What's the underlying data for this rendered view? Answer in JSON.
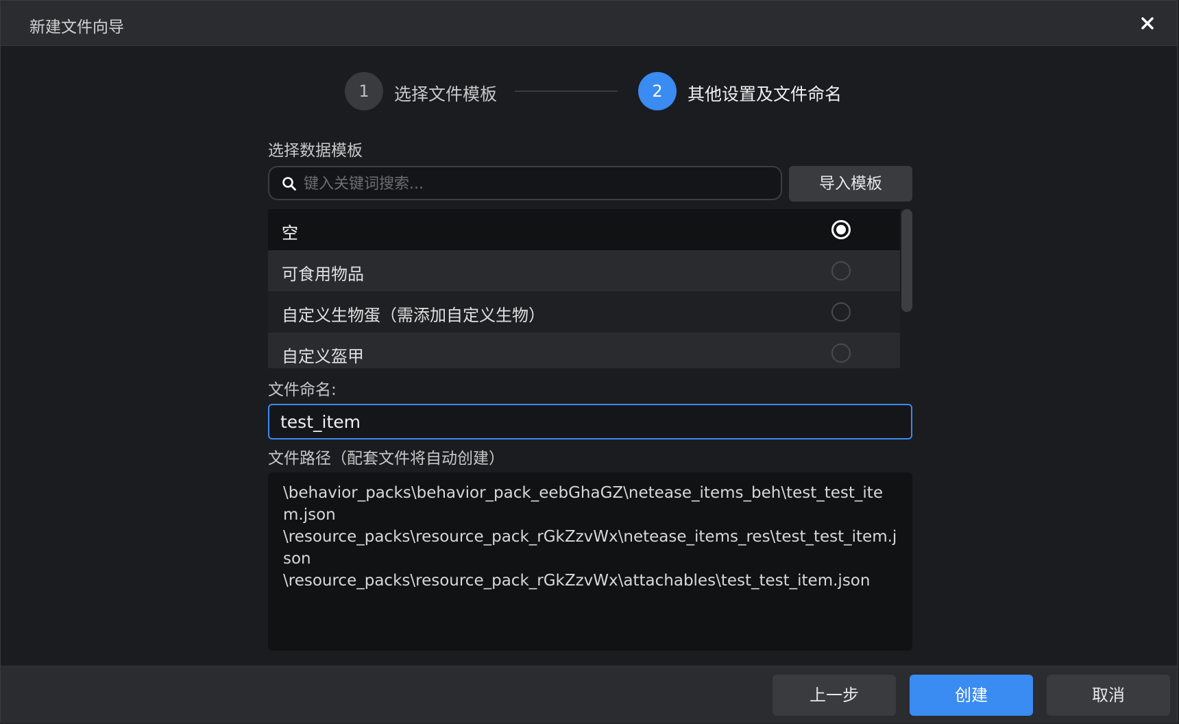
{
  "window": {
    "title": "新建文件向导"
  },
  "stepper": {
    "steps": [
      {
        "number": "1",
        "label": "选择文件模板",
        "state": "done"
      },
      {
        "number": "2",
        "label": "其他设置及文件命名",
        "state": "active"
      }
    ]
  },
  "template_section": {
    "label": "选择数据模板",
    "search_placeholder": "键入关键词搜索...",
    "import_label": "导入模板",
    "items": [
      {
        "label": "空",
        "selected": true
      },
      {
        "label": "可食用物品",
        "selected": false
      },
      {
        "label": "自定义生物蛋（需添加自定义生物）",
        "selected": false
      },
      {
        "label": "自定义盔甲",
        "selected": false
      }
    ]
  },
  "filename_section": {
    "label": "文件命名:",
    "value": "test_item"
  },
  "path_section": {
    "label": "文件路径（配套文件将自动创建）",
    "paths": [
      "\\behavior_packs\\behavior_pack_eebGhaGZ\\netease_items_beh\\test_test_item.json",
      "\\resource_packs\\resource_pack_rGkZzvWx\\netease_items_res\\test_test_item.json",
      "\\resource_packs\\resource_pack_rGkZzvWx\\attachables\\test_test_item.json"
    ]
  },
  "footer": {
    "prev_label": "上一步",
    "create_label": "创建",
    "cancel_label": "取消"
  },
  "colors": {
    "accent": "#3a8bf2",
    "background": "#1b1c1f",
    "titlebar": "#2b2c2f"
  },
  "icons": {
    "close": "close-icon",
    "search": "search-icon"
  }
}
